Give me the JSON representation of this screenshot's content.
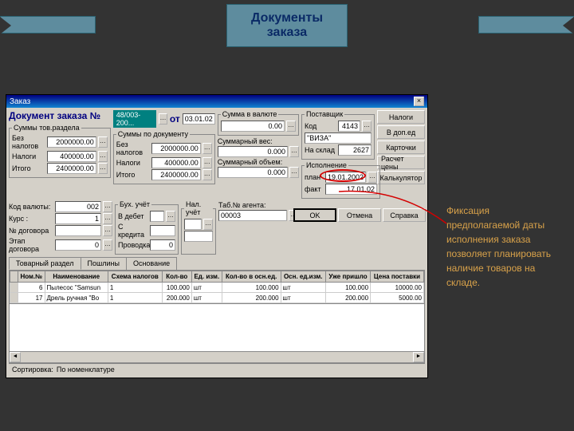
{
  "banner": {
    "line1": "Документы",
    "line2": "заказа"
  },
  "sidetext": "Фиксация предполагаемой даты исполнения заказа позволяет планировать наличие товаров на складе.",
  "window": {
    "title": "Заказ",
    "header_label": "Документ заказа №",
    "doc_number": "48/003-200...",
    "from_label": "от",
    "doc_date": "03.01.02"
  },
  "sums_section": {
    "legend": "Суммы тов.раздела",
    "rows": [
      {
        "label": "Без налогов",
        "value": "2000000.00"
      },
      {
        "label": "Налоги",
        "value": "400000.00"
      },
      {
        "label": "Итого",
        "value": "2400000.00"
      }
    ]
  },
  "sums_doc": {
    "legend": "Суммы по документу",
    "rows": [
      {
        "label": "Без налогов",
        "value": "2000000.00"
      },
      {
        "label": "Налоги",
        "value": "400000.00"
      },
      {
        "label": "Итого",
        "value": "2400000.00"
      }
    ]
  },
  "currency_box": {
    "legend": "Сумма в валюте",
    "value": "0.00",
    "weight_label": "Суммарный вес:",
    "weight_value": "0.000",
    "volume_label": "Суммарный объем:",
    "volume_value": "0.000"
  },
  "supplier": {
    "legend": "Поставщик",
    "code_label": "Код",
    "code_value": "4143",
    "name_value": "\"ВИЗА\"",
    "warehouse_label": "На склад",
    "warehouse_value": "2627"
  },
  "execution": {
    "legend": "Исполнение",
    "plan_label": "план",
    "plan_value": "19.01.2002",
    "fact_label": "факт",
    "fact_value": "17.01.02"
  },
  "buttons": {
    "taxes": "Налоги",
    "add_units": "В доп.ед",
    "cards": "Карточки",
    "calc_price": "Расчет цены",
    "calculator": "Калькулятор"
  },
  "mid_left": {
    "currency_code_label": "Код валюты:",
    "currency_code_value": "002",
    "rate_label": "Курс :",
    "rate_value": "1",
    "contract_label": "№ договора",
    "contract_value": "",
    "stage_label": "Этап договора",
    "stage_value": "0"
  },
  "accounting": {
    "legend": "Бух. учёт",
    "debit_label": "В дебет",
    "credit_label": "С кредита",
    "wiring_label": "Проводка",
    "wiring_value": "0"
  },
  "tax_acc": {
    "legend": "Нал. учёт"
  },
  "agent": {
    "label": "Таб.№ агента:",
    "value": "00003"
  },
  "footer_buttons": {
    "ok": "OK",
    "cancel": "Отмена",
    "help": "Справка"
  },
  "tabs": [
    "Товарный раздел",
    "Пошлины",
    "Основание"
  ],
  "table": {
    "headers": [
      "Ном.№",
      "Наименование",
      "Схема налогов",
      "Кол-во",
      "Ед. изм.",
      "Кол-во в осн.ед.",
      "Осн. ед.изм.",
      "Уже пришло",
      "Цена поставки"
    ],
    "rows": [
      [
        "6",
        "Пылесос \"Samsun",
        "1",
        "100.000",
        "шт",
        "100.000",
        "шт",
        "100.000",
        "10000.00"
      ],
      [
        "17",
        "Дрель ручная \"Во",
        "1",
        "200.000",
        "шт",
        "200.000",
        "шт",
        "200.000",
        "5000.00"
      ]
    ]
  },
  "sort": {
    "label": "Сортировка:",
    "value": "По номенклатуре"
  }
}
